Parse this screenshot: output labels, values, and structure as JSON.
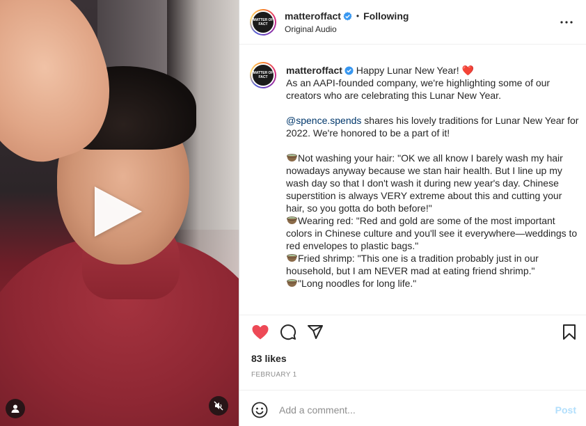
{
  "post": {
    "avatar_text": "MATTER OF FACT",
    "username": "matteroffact",
    "verified_icon": "verified-badge-icon",
    "follow_status": "Following",
    "separator": "•",
    "audio": "Original Audio"
  },
  "caption": {
    "username": "matteroffact",
    "headline": "Happy Lunar New Year!",
    "heart": "❤️",
    "line1": "As an AAPI-founded company, we're highlighting some of our creators who are celebrating this Lunar New Year.",
    "mention": "@spence.spends",
    "line2": " shares his lovely traditions for Lunar New Year for 2022. We're honored to be a part of it!",
    "tip1": "Not washing your hair: \"OK we all know I barely wash my hair nowadays anyway because we stan hair health. But I line up my wash day so that I don't wash it during new year's day. Chinese superstition is always VERY extreme about this and cutting your hair, so you gotta do both before!\"",
    "tip2": "Wearing red: \"Red and gold are some of the most important colors in Chinese culture and you'll see it everywhere—weddings to red envelopes to plastic bags.\"",
    "tip3": "Fried shrimp: \"This one is a tradition probably just in our household, but I am NEVER mad at eating friend shrimp.\"",
    "tip4": "\"Long noodles for long life.\""
  },
  "engagement": {
    "likes": "83 likes",
    "date": "FEBRUARY 1",
    "liked": true,
    "like_color": "#ed4956"
  },
  "comment": {
    "placeholder": "Add a comment...",
    "post_label": "Post",
    "post_color": "#b2dffc"
  },
  "icons": {
    "play": "play-icon",
    "user": "user-icon",
    "mute": "muted-speaker-icon",
    "more": "more-options-icon",
    "like": "heart-icon",
    "comment": "comment-icon",
    "share": "share-icon",
    "save": "bookmark-icon",
    "emoji": "emoji-icon",
    "bowl": "bowl-icon"
  }
}
